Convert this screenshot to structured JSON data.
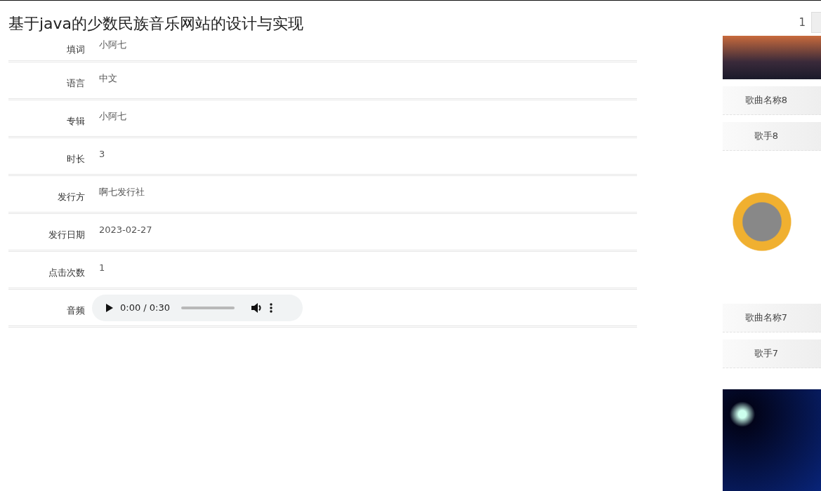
{
  "title": "基于java的少数民族音乐网站的设计与实现",
  "pager": {
    "current": "1"
  },
  "fields": [
    {
      "kind": "text",
      "label": "填词",
      "value": "小阿七"
    },
    {
      "kind": "text",
      "label": "语言",
      "value": "中文"
    },
    {
      "kind": "text",
      "label": "专辑",
      "value": "小阿七"
    },
    {
      "kind": "text",
      "label": "时长",
      "value": "3"
    },
    {
      "kind": "text",
      "label": "发行方",
      "value": "啊七发行社"
    },
    {
      "kind": "text",
      "label": "发行日期",
      "value": "2023-02-27"
    },
    {
      "kind": "text",
      "label": "点击次数",
      "value": "1"
    },
    {
      "kind": "audio",
      "label": "音频",
      "value": "0:00 / 0:30"
    }
  ],
  "songs": [
    {
      "kind": "card",
      "name": "歌曲名称8",
      "singer": "歌手8"
    },
    {
      "kind": "card",
      "name": "歌曲名称7",
      "singer": "歌手7"
    },
    {
      "kind": "photo"
    }
  ]
}
